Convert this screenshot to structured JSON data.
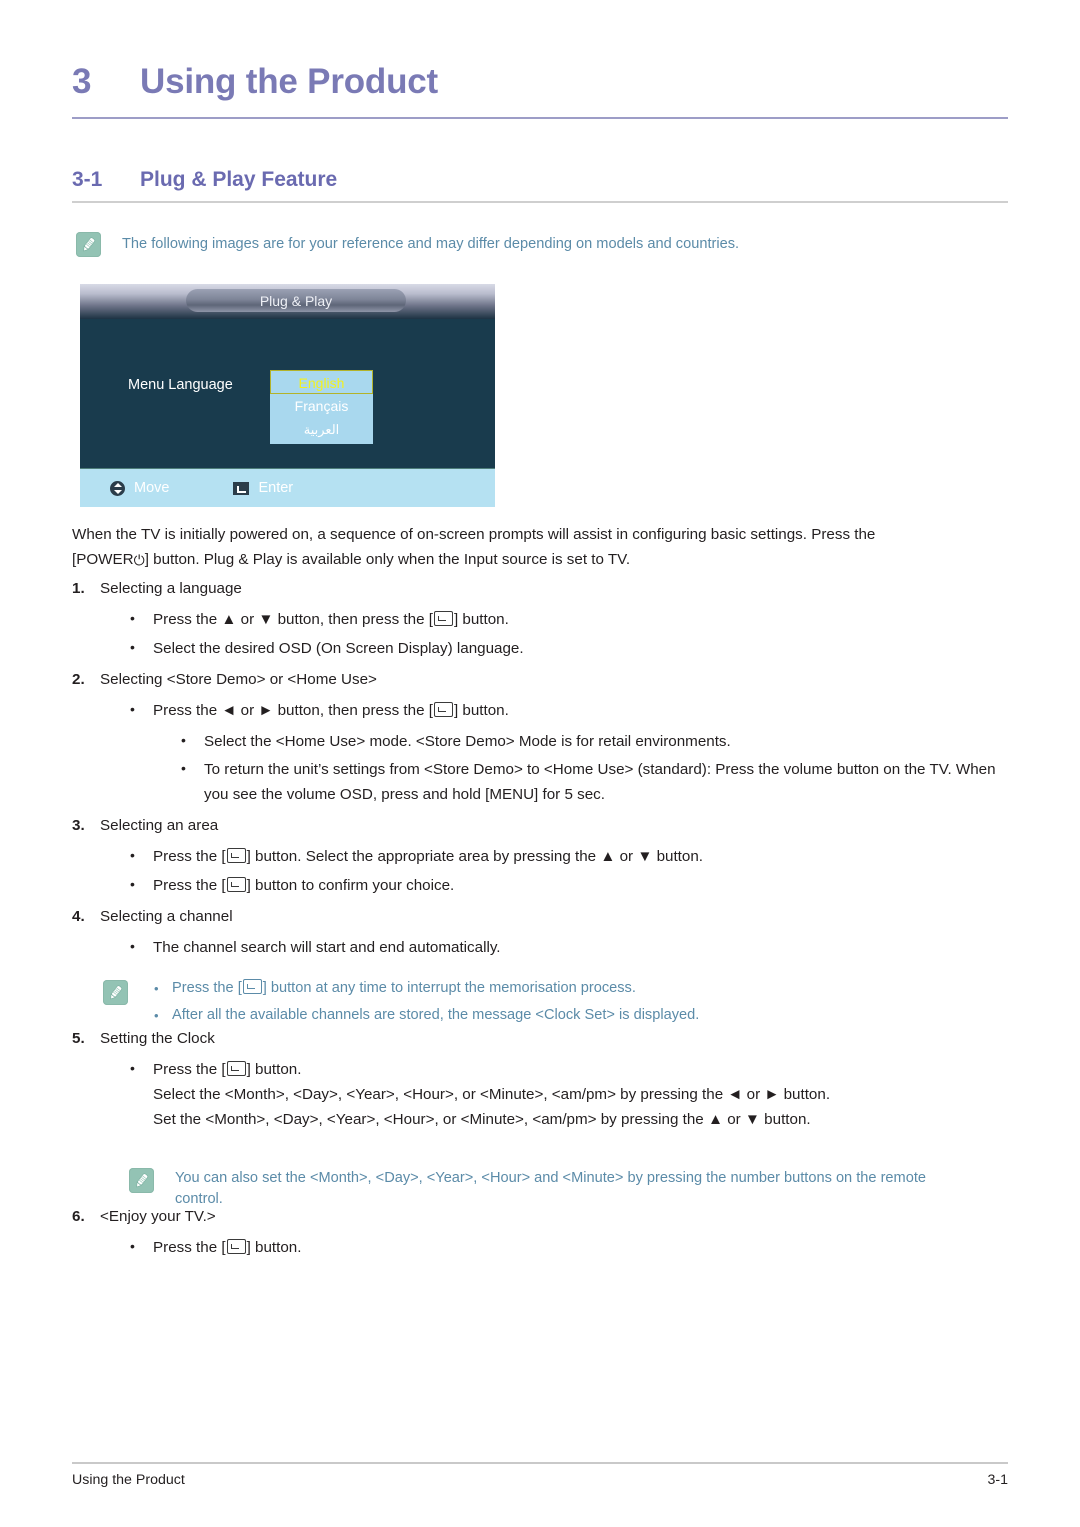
{
  "chapter": {
    "number": "3",
    "title": "Using the Product"
  },
  "section": {
    "number": "3-1",
    "title": "Plug & Play Feature"
  },
  "notes": {
    "top": "The following images are for your reference and may differ depending on models and countries.",
    "middle": [
      "Press the [⌤] button at any time to interrupt the memorisation process.",
      "After all the available channels are stored, the message <Clock Set> is displayed."
    ],
    "middle_parts": {
      "item1_before": "Press the [",
      "item1_after": "] button at any time to interrupt the memorisation process.",
      "item2": "After all the available channels are stored, the message <Clock Set> is displayed."
    },
    "bottom": "You can also set the <Month>, <Day>, <Year>, <Hour> and <Minute> by pressing the number buttons on the remote control.",
    "icon": "pencil-note-icon",
    "icon_color": "#93c3b4",
    "text_color": "#5b8ba8"
  },
  "osd": {
    "title": "Plug & Play",
    "menu_label": "Menu Language",
    "options": [
      {
        "label": "English",
        "selected": true
      },
      {
        "label": "Français",
        "selected": false
      },
      {
        "label": "العربية",
        "selected": false
      }
    ],
    "footer": {
      "move_label": "Move",
      "move_icon": "up-down-arrow-icon",
      "enter_label": "Enter",
      "enter_icon": "enter-key-icon"
    },
    "colors": {
      "body_bg": "#193b4d",
      "select_bg": "#a9d8ee",
      "selected_text": "#f3f11f",
      "footer_bg": "#b5e1f2"
    }
  },
  "intro": {
    "line1": "When the TV is initially powered on, a sequence of on-screen prompts will assist in configuring basic settings. Press the",
    "line2_before": "[POWER",
    "line2_power_symbol": "⏻",
    "line2_after": "] button. Plug & Play is available only when the Input source is set to TV."
  },
  "steps": [
    {
      "num": "1.",
      "title": "Selecting a language",
      "bullets": [
        {
          "before": "Press the ▲ or ▼ button, then press the [",
          "key": true,
          "after": "] button."
        },
        {
          "before": "Select the desired OSD (On Screen Display) language.",
          "key": false,
          "after": ""
        }
      ]
    },
    {
      "num": "2.",
      "title": "Selecting <Store Demo> or <Home Use>",
      "bullets": [
        {
          "before": "Press the ◄ or ► button, then press the [",
          "key": true,
          "after": "] button."
        }
      ],
      "subbullets": [
        "Select the <Home Use> mode. <Store Demo> Mode is for retail environments.",
        "To return the unit’s settings from <Store Demo> to <Home Use> (standard): Press the volume button on the TV. When you see the volume OSD, press and hold [MENU] for 5 sec."
      ]
    },
    {
      "num": "3.",
      "title": "Selecting an area",
      "bullets": [
        {
          "before": "Press the [",
          "key": true,
          "after": "] button. Select the appropriate area by pressing the ▲ or ▼ button."
        },
        {
          "before": "Press the [",
          "key": true,
          "after": "] button to confirm your choice."
        }
      ]
    },
    {
      "num": "4.",
      "title": "Selecting a channel",
      "bullets": [
        {
          "before": "The channel search will start and end automatically.",
          "key": false,
          "after": ""
        }
      ]
    },
    {
      "num": "5.",
      "title": "Setting the Clock",
      "bullets": [
        {
          "before": "Press the [",
          "key": true,
          "after": "] button."
        }
      ],
      "extra_lines": [
        "Select the <Month>, <Day>, <Year>, <Hour>, or <Minute>, <am/pm> by pressing the ◄ or ► button.",
        "Set the <Month>, <Day>, <Year>, <Hour>, or <Minute>, <am/pm> by pressing the ▲ or ▼ button."
      ]
    },
    {
      "num": "6.",
      "title": "<Enjoy your TV.>",
      "bullets": [
        {
          "before": "Press the [",
          "key": true,
          "after": "] button."
        }
      ]
    }
  ],
  "footer": {
    "left": "Using the Product",
    "right": "3-1"
  }
}
